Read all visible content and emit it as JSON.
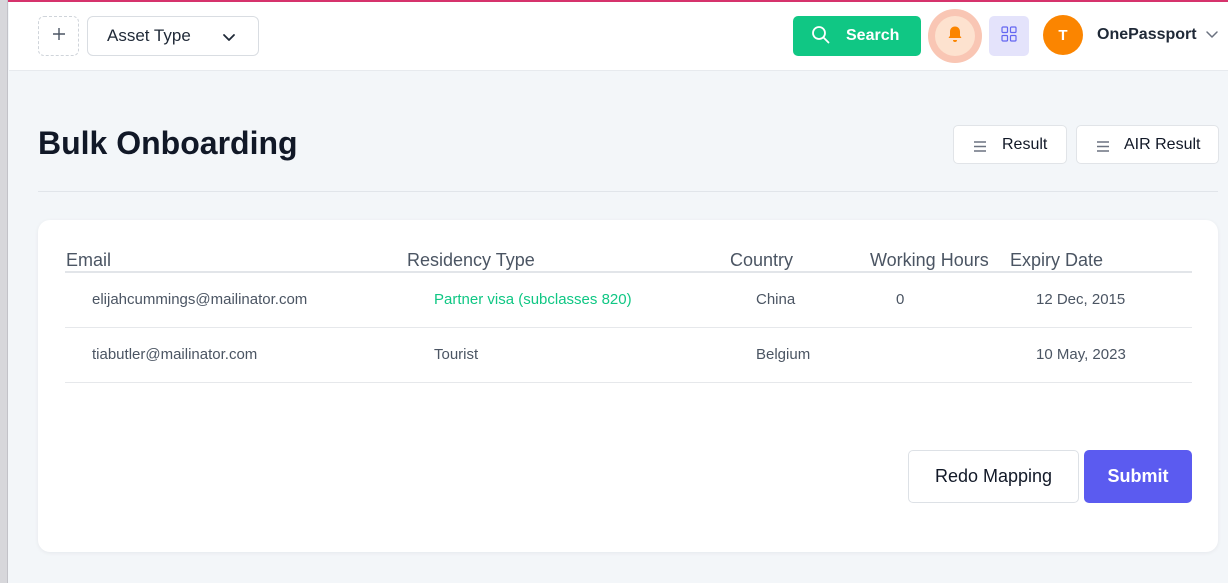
{
  "header": {
    "asset_type_label": "Asset Type",
    "search_label": "Search",
    "avatar_initial": "T",
    "org_name": "OnePassport"
  },
  "page": {
    "title": "Bulk Onboarding",
    "result_label": "Result",
    "air_result_label": "AIR Result"
  },
  "table": {
    "columns": [
      "Email",
      "Residency Type",
      "Country",
      "Working Hours",
      "Expiry Date"
    ],
    "rows": [
      {
        "email": "elijahcummings@mailinator.com",
        "residency_type": "Partner visa (subclasses 820)",
        "country": "China",
        "working_hours": "0",
        "expiry_date": "12 Dec, 2015"
      },
      {
        "email": "tiabutler@mailinator.com",
        "residency_type": "Tourist",
        "country": "Belgium",
        "working_hours": "",
        "expiry_date": "10 May, 2023"
      }
    ]
  },
  "actions": {
    "redo_label": "Redo Mapping",
    "submit_label": "Submit"
  },
  "colors": {
    "accent_green": "#10c784",
    "submit_purple": "#5b5bf0",
    "avatar_orange": "#fb8500",
    "top_accent": "#d6336c"
  },
  "icons": [
    "plus-icon",
    "chevron-down-icon",
    "search-icon",
    "bell-icon",
    "grid-icon",
    "menu-icon"
  ]
}
